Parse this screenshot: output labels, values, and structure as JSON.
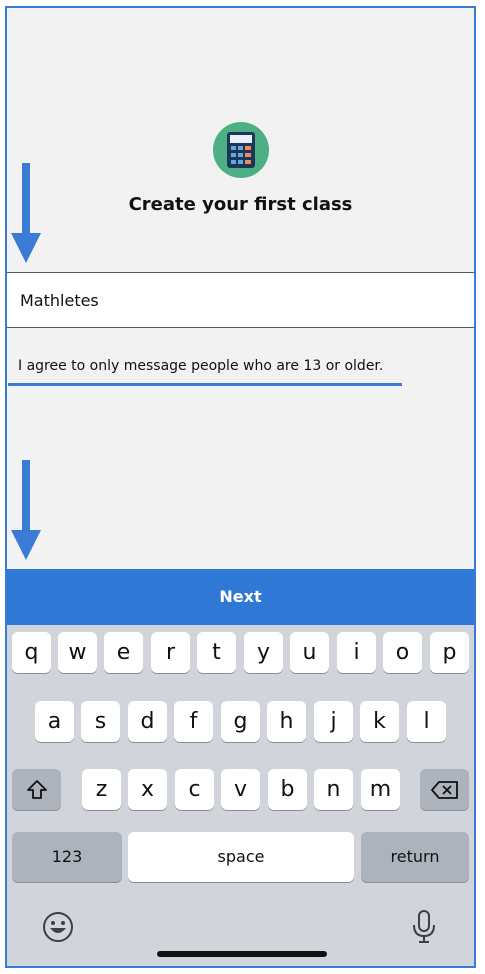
{
  "screen": {
    "title": "Create your first class",
    "class_name_value": "Mathletes",
    "agreement_text": "I agree to only message people who are 13 or older.",
    "next_label": "Next",
    "accent_color": "#2f78d6"
  },
  "keyboard": {
    "row1": [
      "q",
      "w",
      "e",
      "r",
      "t",
      "y",
      "u",
      "i",
      "o",
      "p"
    ],
    "row2": [
      "a",
      "s",
      "d",
      "f",
      "g",
      "h",
      "j",
      "k",
      "l"
    ],
    "row3": [
      "z",
      "x",
      "c",
      "v",
      "b",
      "n",
      "m"
    ],
    "numbers_label": "123",
    "space_label": "space",
    "return_label": "return",
    "shift_icon": "shift-icon",
    "delete_icon": "backspace-icon",
    "emoji_icon": "emoji-icon",
    "mic_icon": "microphone-icon"
  }
}
